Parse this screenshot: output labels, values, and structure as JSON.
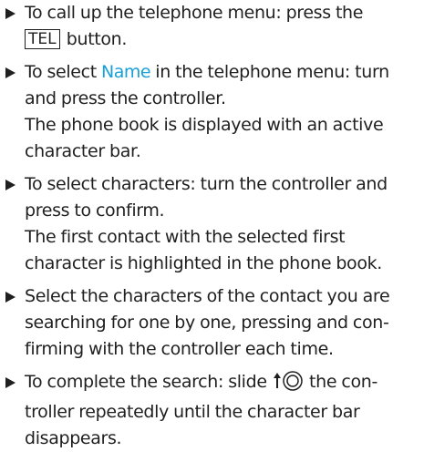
{
  "steps": [
    {
      "id": "call_menu",
      "text_before": "To call up the telephone menu: press the",
      "button_label": "TEL",
      "text_after": " button."
    },
    {
      "id": "select_name",
      "text_before": "To select ",
      "menu_term": "Name",
      "text_after": " in the telephone menu: turn and press the controller.",
      "result": "The phone book is displayed with an active character bar."
    },
    {
      "id": "select_characters",
      "text": "To select characters: turn the controller and press to confirm.",
      "result": "The first contact with the selected first character is highlighted in the phone book."
    },
    {
      "id": "select_contact_characters",
      "text": "Select the characters of the contact you are searching for one by one, pressing and con­firming with the controller each time."
    },
    {
      "id": "complete_search",
      "text_before": "To complete the search: slide ",
      "icon": "slide-up-controller-icon",
      "text_after": " the con­troller repeatedly until the character bar disappears."
    }
  ],
  "colors": {
    "text": "#1f1f1f",
    "menu_term": "#1aa0d8"
  }
}
